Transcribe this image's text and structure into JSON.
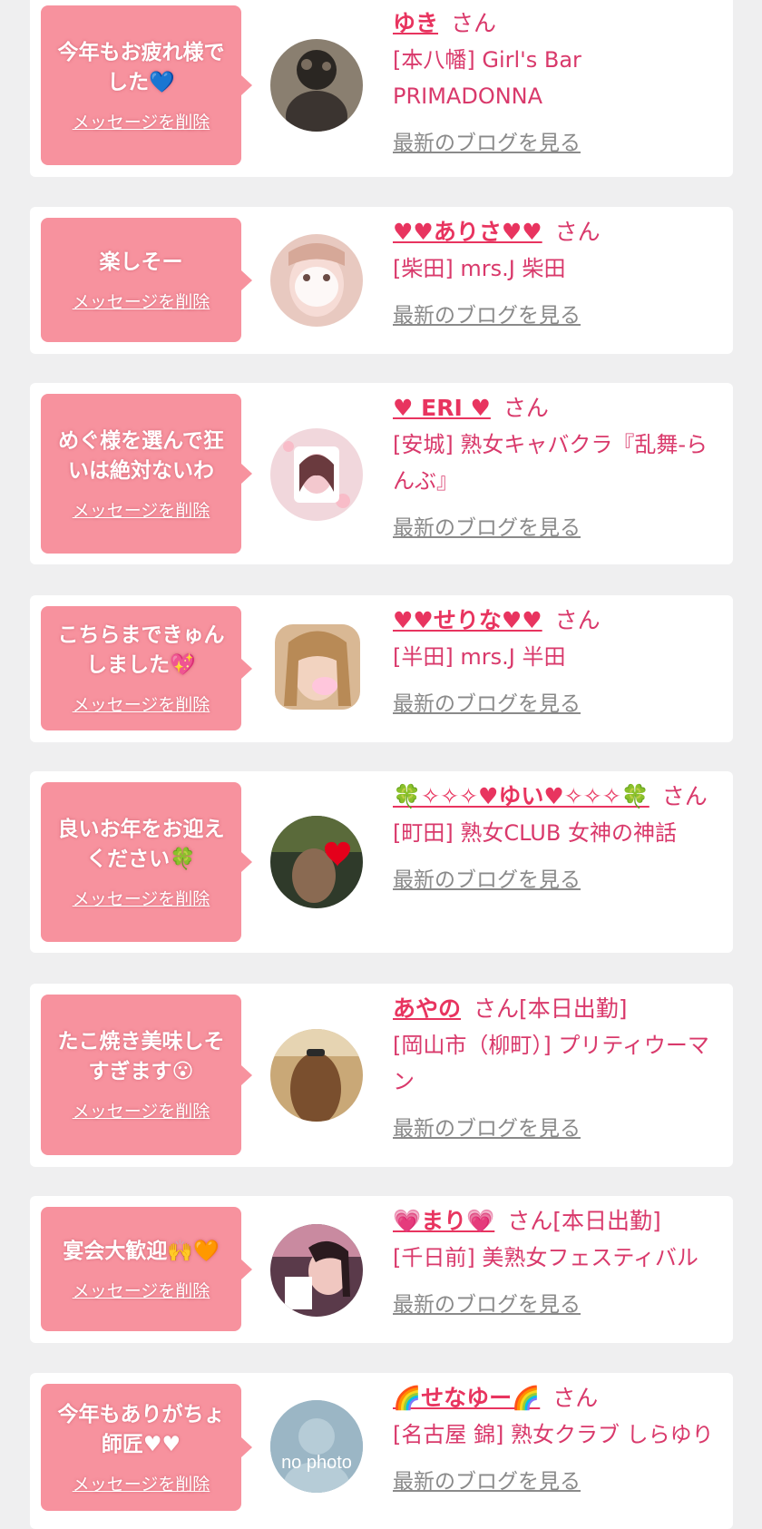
{
  "colors": {
    "page_bg": "#efeff0",
    "card_bg": "#ffffff",
    "bubble_bg": "#f7929e",
    "name": "#e8345f",
    "shop": "#d9396b",
    "blog_link": "#8a8a8a"
  },
  "labels": {
    "delete_message": "メッセージを削除",
    "latest_blog": "最新のブログを見る",
    "honorific": "さん"
  },
  "items": [
    {
      "message": "今年もお疲れ様でした💙",
      "name": "ゆき",
      "status": "",
      "shop": "[本八幡] Girl's Bar PRIMADONNA",
      "avatar": "dark-hair-photo"
    },
    {
      "message": "楽しそー",
      "name": "♥♥ありさ♥♥",
      "status": "",
      "shop": "[柴田] mrs.J 柴田",
      "avatar": "pink-face-photo"
    },
    {
      "message": "めぐ様を選んで狂いは絶対ないわ",
      "name": "♥ ERI ♥",
      "status": "",
      "shop": "[安城] 熟女キャバクラ『乱舞-らんぶ』",
      "avatar": "pink-frame-photo"
    },
    {
      "message": "こちらまできゅんしました💖",
      "name": "♥♥せりな♥♥",
      "status": "",
      "shop": "[半田] mrs.J 半田",
      "avatar": "blonde-photo"
    },
    {
      "message": "良いお年をお迎えください🍀",
      "name": "🍀✧✧✧♥ゆい♥✧✧✧🍀",
      "status": "",
      "shop": "[町田] 熟女CLUB 女神の神話",
      "avatar": "heart-sticker-photo"
    },
    {
      "message": "たこ焼き美味しそすぎます😮",
      "name": "あやの",
      "status": "[本日出勤]",
      "shop": "[岡山市（柳町）] プリティウーマン",
      "avatar": "hair-clip-photo"
    },
    {
      "message": "宴会大歓迎🙌🧡",
      "name": "💗まり💗",
      "status": "[本日出勤]",
      "shop": "[千日前] 美熟女フェスティバル",
      "avatar": "party-photo"
    },
    {
      "message": "今年もありがちょ師匠♥♥",
      "name": "🌈せなゆー🌈",
      "status": "",
      "shop": "[名古屋 錦] 熟女クラブ しらゆり",
      "avatar": "no-photo-placeholder",
      "avatar_text": "no photo"
    }
  ]
}
